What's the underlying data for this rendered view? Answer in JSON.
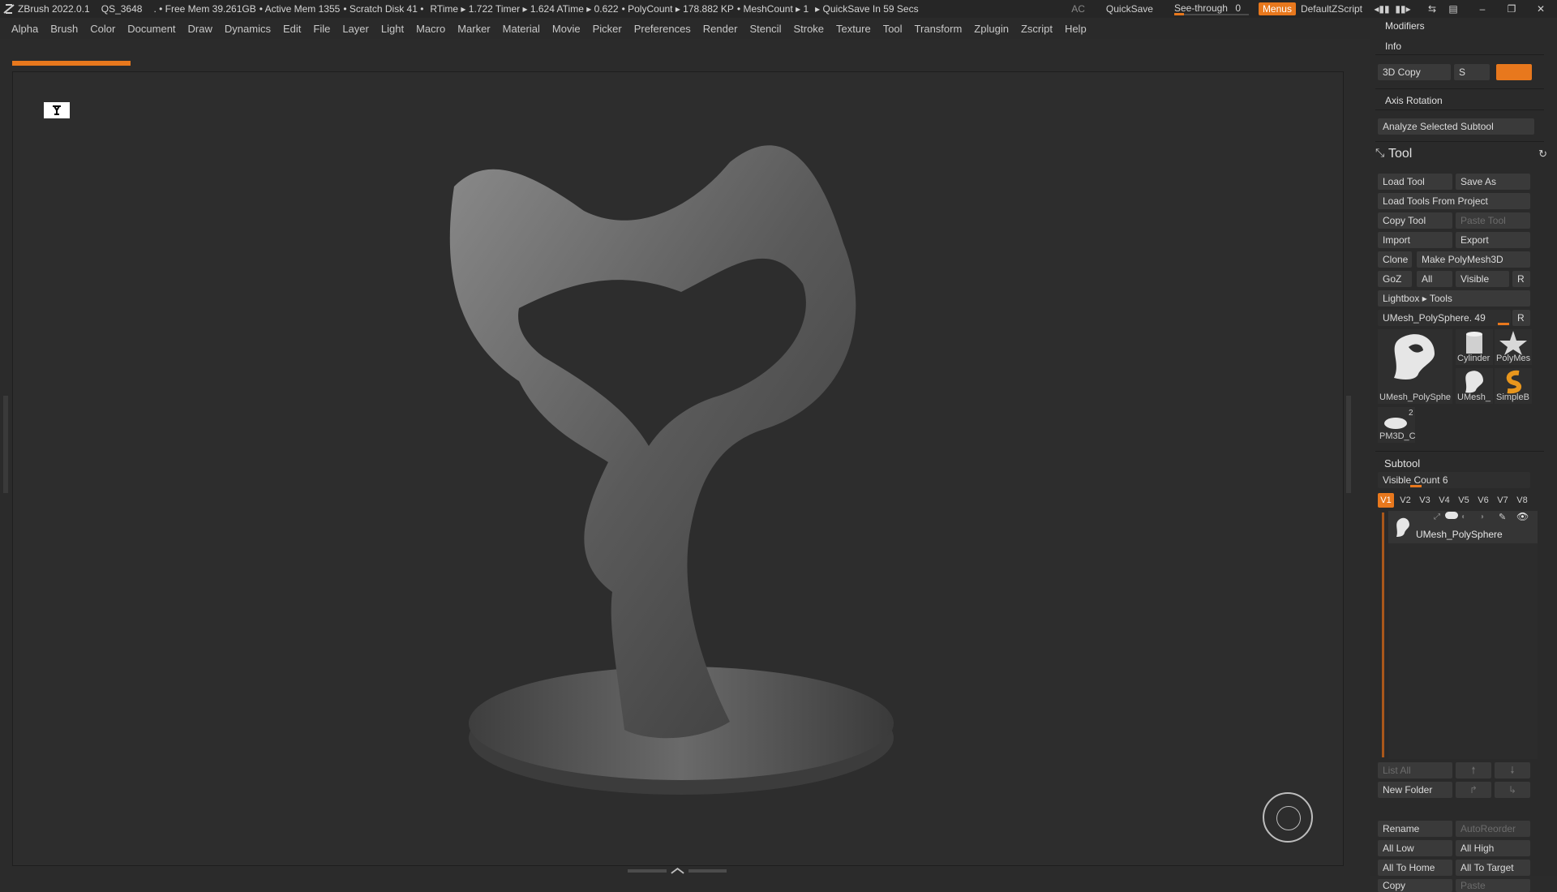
{
  "titlebar": {
    "app": "ZBrush 2022.0.1",
    "doc": "QS_3648",
    "free_mem": ". • Free Mem 39.261GB",
    "active_mem": "• Active Mem 1355",
    "scratch": "• Scratch Disk 41 •",
    "timing": "RTime ▸ 1.722 Timer ▸ 1.624 ATime ▸ 0.622",
    "polycount": "• PolyCount ▸ 178.882 KP",
    "meshcount": "• MeshCount ▸ 1",
    "quicksave_timer": "▸ QuickSave In 59 Secs",
    "ac": "AC",
    "quicksave": "QuickSave",
    "seethrough_label": "See-through",
    "seethrough_value": "0",
    "seethrough_level": 0.0,
    "menus": "Menus",
    "script": "DefaultZScript"
  },
  "menubar": [
    "Alpha",
    "Brush",
    "Color",
    "Document",
    "Draw",
    "Dynamics",
    "Edit",
    "File",
    "Layer",
    "Light",
    "Macro",
    "Marker",
    "Material",
    "Movie",
    "Picker",
    "Preferences",
    "Render",
    "Stencil",
    "Stroke",
    "Texture",
    "Tool",
    "Transform",
    "Zplugin",
    "Zscript",
    "Help"
  ],
  "rpanel": {
    "modifiers": "Modifiers",
    "info": "Info",
    "copy3d": "3D Copy",
    "s_label": "S",
    "axis_rotation": "Axis Rotation",
    "analyze": "Analyze Selected Subtool",
    "tool_title": "Tool",
    "load_tool": "Load Tool",
    "save_as": "Save As",
    "load_from_project": "Load Tools From Project",
    "copy_tool": "Copy Tool",
    "paste_tool": "Paste Tool",
    "import": "Import",
    "export": "Export",
    "clone": "Clone",
    "make_polymesh": "Make PolyMesh3D",
    "goz": "GoZ",
    "all": "All",
    "visible": "Visible",
    "r": "R",
    "lightbox": "Lightbox ▸ Tools",
    "current_tool": "UMesh_PolySphere. 49",
    "thumbs": {
      "big": "UMesh_PolySphe",
      "cylinder": "Cylinder",
      "polymesh": "PolyMes",
      "umesh": "UMesh_",
      "simpleb": "SimpleB",
      "pm3d": "PM3D_C",
      "pm3d_count": "2"
    },
    "subtool_title": "Subtool",
    "visible_count": "Visible Count 6",
    "vtabs": [
      "V1",
      "V2",
      "V3",
      "V4",
      "V5",
      "V6",
      "V7",
      "V8"
    ],
    "subtool_name": "UMesh_PolySphere",
    "list_all": "List All",
    "new_folder": "New Folder",
    "rename": "Rename",
    "autoreorder": "AutoReorder",
    "all_low": "All Low",
    "all_high": "All High",
    "all_to_home": "All To Home",
    "all_to_target": "All To Target",
    "copy": "Copy",
    "paste": "Paste"
  }
}
